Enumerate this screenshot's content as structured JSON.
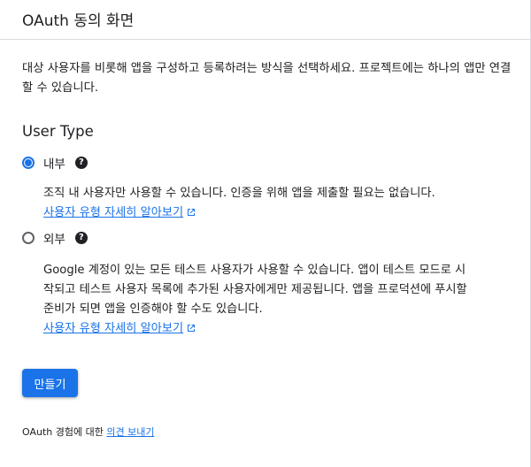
{
  "header": {
    "title": "OAuth 동의 화면"
  },
  "intro": "대상 사용자를 비롯해 앱을 구성하고 등록하려는 방식을 선택하세요. 프로젝트에는 하나의 앱만 연결할 수 있습니다.",
  "user_type": {
    "title": "User Type",
    "options": [
      {
        "label": "내부",
        "selected": true,
        "description": "조직 내 사용자만 사용할 수 있습니다. 인증을 위해 앱을 제출할 필요는 없습니다.",
        "link_text": "사용자 유형 자세히 알아보기"
      },
      {
        "label": "외부",
        "selected": false,
        "description": "Google 계정이 있는 모든 테스트 사용자가 사용할 수 있습니다. 앱이 테스트 모드로 시작되고 테스트 사용자 목록에 추가된 사용자에게만 제공됩니다. 앱을 프로덕션에 푸시할 준비가 되면 앱을 인증해야 할 수도 있습니다.",
        "link_text": "사용자 유형 자세히 알아보기"
      }
    ]
  },
  "actions": {
    "create_label": "만들기"
  },
  "feedback": {
    "prefix": "OAuth 경험에 대한 ",
    "link_text": "의견 보내기"
  },
  "icons": {
    "help": "help-icon",
    "external_link": "external-link-icon"
  },
  "colors": {
    "accent": "#1a73e8",
    "text": "#202124",
    "border": "#dadce0"
  }
}
